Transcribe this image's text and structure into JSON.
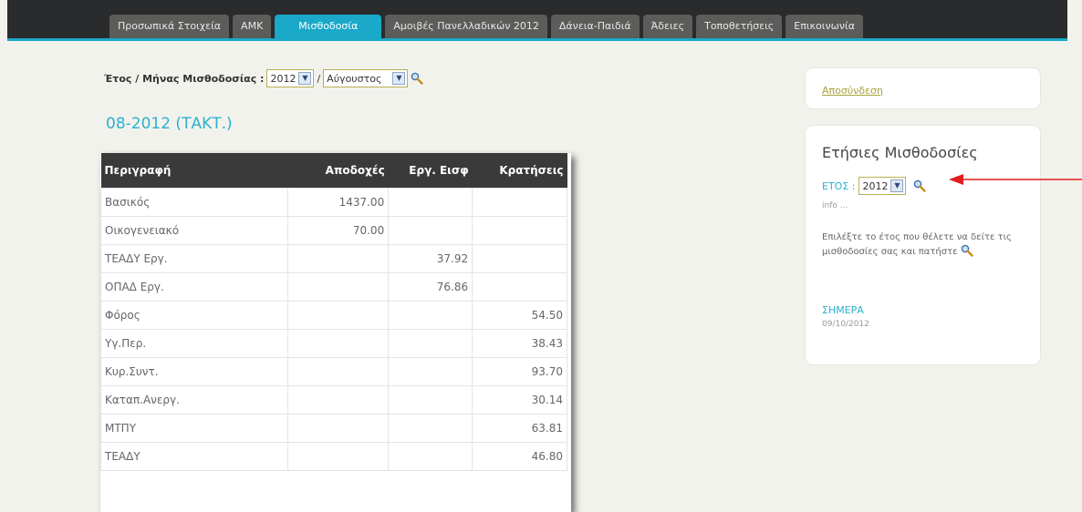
{
  "nav": {
    "tabs": [
      {
        "label": "Προσωπικά Στοιχεία",
        "active": false
      },
      {
        "label": "ΑΜΚ",
        "active": false
      },
      {
        "label": "Μισθοδοσία",
        "active": true
      },
      {
        "label": "Αμοιβές Πανελλαδικών 2012",
        "active": false
      },
      {
        "label": "Δάνεια-Παιδιά",
        "active": false
      },
      {
        "label": "Άδειες",
        "active": false
      },
      {
        "label": "Τοποθετήσεις",
        "active": false
      },
      {
        "label": "Επικοινωνία",
        "active": false
      }
    ],
    "accent": "#1aa9c8"
  },
  "period": {
    "label": "Έτος / Μήνας Μισθοδοσίας :",
    "separator": "/",
    "year": "2012",
    "month": "Αύγουστος",
    "search_icon": "magnifier-icon"
  },
  "payroll_title": "08-2012 (ΤΑΚΤ.)",
  "table": {
    "headers": [
      "Περιγραφή",
      "Αποδοχές",
      "Εργ. Εισφ",
      "Κρατήσεις"
    ],
    "rows": [
      [
        "Βασικός",
        "1437.00",
        "",
        ""
      ],
      [
        "Οικογενειακό",
        "70.00",
        "",
        ""
      ],
      [
        "ΤΕΑΔΥ Εργ.",
        "",
        "37.92",
        ""
      ],
      [
        "ΟΠΑΔ Εργ.",
        "",
        "76.86",
        ""
      ],
      [
        "Φόρος",
        "",
        "",
        "54.50"
      ],
      [
        "Υγ.Περ.",
        "",
        "",
        "38.43"
      ],
      [
        "Κυρ.Συντ.",
        "",
        "",
        "93.70"
      ],
      [
        "Καταπ.Ανεργ.",
        "",
        "",
        "30.14"
      ],
      [
        "ΜΤΠΥ",
        "",
        "",
        "63.81"
      ],
      [
        "ΤΕΑΔΥ",
        "",
        "",
        "46.80"
      ]
    ]
  },
  "sidebar": {
    "logout": "Αποσύνδεση",
    "annual": {
      "title": "Ετήσιες Μισθοδοσίες",
      "year_label": "ΕΤΟΣ :",
      "year": "2012",
      "info": "info ...",
      "help": "Επιλέξτε το έτος που θέλετε να δείτε τις μισθοδοσίες σας και πατήστε",
      "today_label": "ΣΗΜΕΡΑ",
      "today_date": "09/10/2012"
    }
  },
  "annotation_color": "#e11d1d"
}
